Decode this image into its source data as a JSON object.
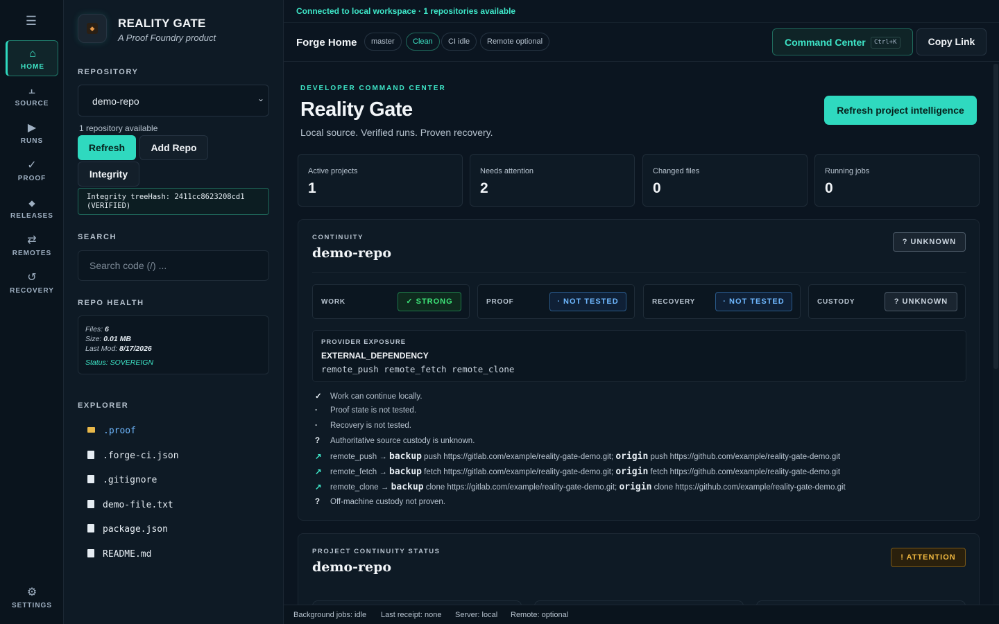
{
  "rail": {
    "items": [
      {
        "label": "HOME",
        "icon": "home-icon",
        "glyph": "⌂"
      },
      {
        "label": "SOURCE",
        "icon": "branch-icon",
        "glyph": "⫠"
      },
      {
        "label": "RUNS",
        "icon": "play-icon",
        "glyph": "▶"
      },
      {
        "label": "PROOF",
        "icon": "check-icon",
        "glyph": "✓"
      },
      {
        "label": "RELEASES",
        "icon": "diamond-icon",
        "glyph": "◆"
      },
      {
        "label": "REMOTES",
        "icon": "swap-icon",
        "glyph": "⇄"
      },
      {
        "label": "RECOVERY",
        "icon": "restore-icon",
        "glyph": "↺"
      }
    ],
    "settings": {
      "label": "SETTINGS",
      "glyph": "⚙"
    }
  },
  "brand": {
    "title": "REALITY GATE",
    "subtitle": "A Proof Foundry product"
  },
  "sidebar": {
    "repository_label": "REPOSITORY",
    "selected_repo": "demo-repo",
    "repo_count": "1 repository available",
    "refresh": "Refresh",
    "add_repo": "Add Repo",
    "integrity": "Integrity",
    "integrity_text": "Integrity treeHash: 2411cc8623208cd1 (VERIFIED)",
    "search_label": "SEARCH",
    "search_placeholder": "Search code (/) ...",
    "health_label": "REPO HEALTH",
    "health": {
      "files_label": "Files:",
      "files": "6",
      "size_label": "Size:",
      "size": "0.01 MB",
      "lastmod_label": "Last Mod:",
      "lastmod": "8/17/2026",
      "status": "Status: SOVEREIGN"
    },
    "explorer_label": "EXPLORER",
    "files": [
      ".proof",
      ".forge-ci.json",
      ".gitignore",
      "demo-file.txt",
      "package.json",
      "README.md"
    ]
  },
  "topbar": {
    "connection": "Connected to local workspace · 1 repositories available",
    "title": "Forge Home",
    "pills": [
      "master",
      "Clean",
      "CI idle",
      "Remote optional"
    ],
    "command_center": "Command Center",
    "shortcut": "Ctrl+K",
    "copy_link": "Copy Link"
  },
  "hero": {
    "eyebrow": "DEVELOPER COMMAND CENTER",
    "title": "Reality Gate",
    "tagline": "Local source. Verified runs. Proven recovery.",
    "refresh_intel": "Refresh project intelligence"
  },
  "stats": [
    {
      "label": "Active projects",
      "value": "1"
    },
    {
      "label": "Needs attention",
      "value": "2"
    },
    {
      "label": "Changed files",
      "value": "0"
    },
    {
      "label": "Running jobs",
      "value": "0"
    }
  ],
  "continuity": {
    "eyebrow": "CONTINUITY",
    "name": "demo-repo",
    "badge": "? UNKNOWN",
    "cells": [
      {
        "label": "WORK",
        "badge": "✓ STRONG"
      },
      {
        "label": "PROOF",
        "badge": "· NOT TESTED"
      },
      {
        "label": "RECOVERY",
        "badge": "· NOT TESTED"
      },
      {
        "label": "CUSTODY",
        "badge": "? UNKNOWN"
      }
    ],
    "provider": {
      "label": "PROVIDER EXPOSURE",
      "value": "EXTERNAL_DEPENDENCY",
      "caps": "remote_push remote_fetch remote_clone"
    },
    "notes": [
      {
        "mark": "✓",
        "text": "Work can continue locally."
      },
      {
        "mark": "·",
        "text": "Proof state is not tested."
      },
      {
        "mark": "·",
        "text": "Recovery is not tested."
      },
      {
        "mark": "?",
        "text": "Authoritative source custody is unknown."
      },
      {
        "mark": "↗",
        "pre": "remote_push → ",
        "r1": "backup",
        "mid": " push https://gitlab.com/example/reality-gate-demo.git; ",
        "r2": "origin",
        "post": " push https://github.com/example/reality-gate-demo.git"
      },
      {
        "mark": "↗",
        "pre": "remote_fetch → ",
        "r1": "backup",
        "mid": " fetch https://gitlab.com/example/reality-gate-demo.git; ",
        "r2": "origin",
        "post": " fetch https://github.com/example/reality-gate-demo.git"
      },
      {
        "mark": "↗",
        "pre": "remote_clone → ",
        "r1": "backup",
        "mid": " clone https://gitlab.com/example/reality-gate-demo.git; ",
        "r2": "origin",
        "post": " clone https://github.com/example/reality-gate-demo.git"
      },
      {
        "mark": "?",
        "text": "Off-machine custody not proven."
      }
    ]
  },
  "project_status": {
    "eyebrow": "PROJECT CONTINUITY STATUS",
    "name": "demo-repo",
    "badge": "! ATTENTION"
  },
  "statusbar": {
    "jobs": "Background jobs: idle",
    "receipt": "Last receipt: none",
    "server": "Server: local",
    "remote": "Remote: optional"
  },
  "colors": {
    "accent": "#2fd9bf",
    "background": "#0b1520",
    "attention": "#f0b840",
    "not_tested": "#6fb8ff",
    "strong": "#3ee67a"
  }
}
